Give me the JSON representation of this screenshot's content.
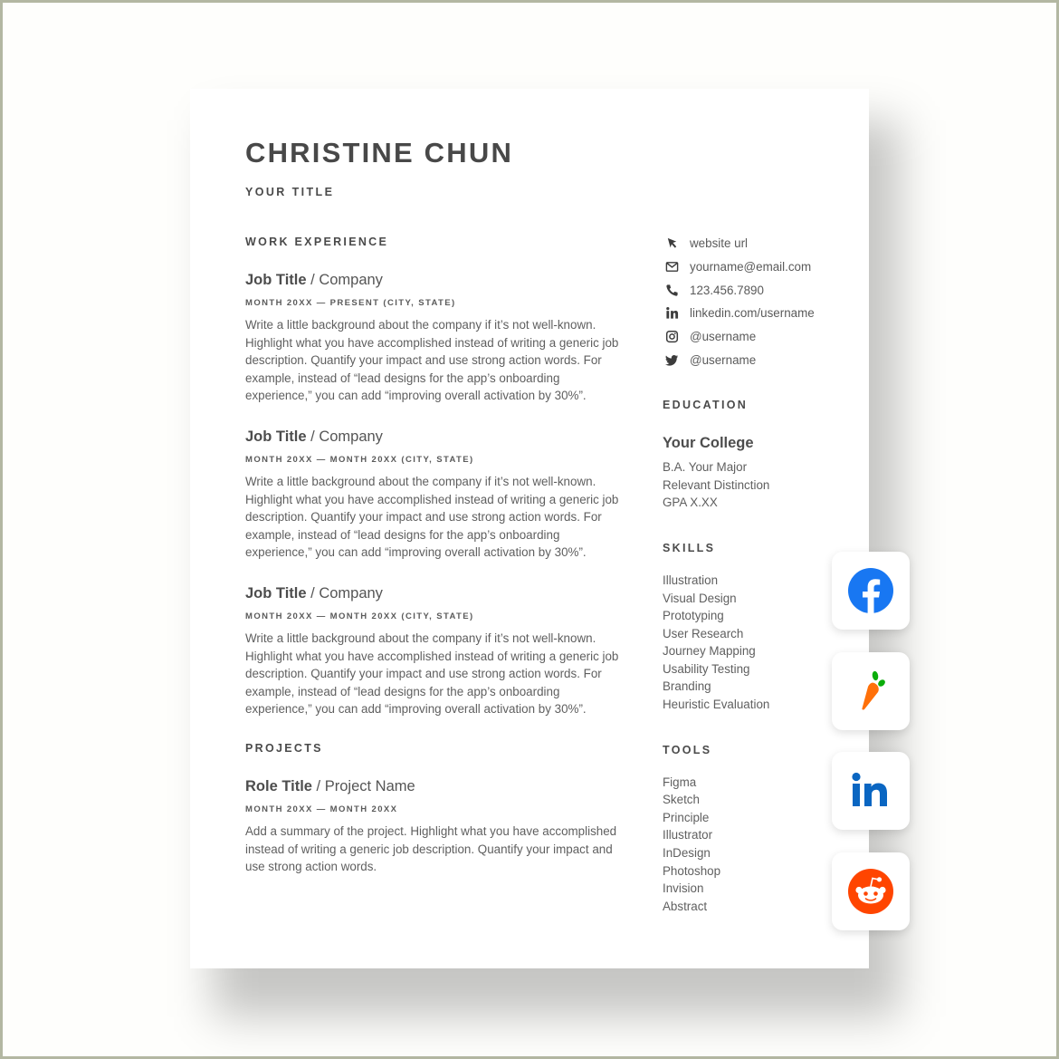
{
  "resume": {
    "name": "CHRISTINE CHUN",
    "title": "YOUR TITLE",
    "work_experience": {
      "heading": "WORK EXPERIENCE",
      "entries": [
        {
          "role": "Job Title",
          "separator": " / ",
          "org": "Company",
          "meta": "MONTH 20XX — PRESENT (CITY, STATE)",
          "description": "Write a little background about the company if it’s not well-known. Highlight what you have accomplished instead of writing a generic job description. Quantify your impact and use strong action words. For example, instead of “lead designs for the app’s onboarding experience,” you can add “improving overall activation by 30%”."
        },
        {
          "role": "Job Title",
          "separator": " / ",
          "org": "Company",
          "meta": "MONTH 20XX — MONTH 20XX (CITY, STATE)",
          "description": "Write a little background about the company if it’s not well-known. Highlight what you have accomplished instead of writing a generic job description. Quantify your impact and use strong action words. For example, instead of “lead designs for the app’s onboarding experience,” you can add “improving overall activation by 30%”."
        },
        {
          "role": "Job Title",
          "separator": " / ",
          "org": "Company",
          "meta": "MONTH 20XX — MONTH 20XX (CITY, STATE)",
          "description": "Write a little background about the company if it’s not well-known. Highlight what you have accomplished instead of writing a generic job description. Quantify your impact and use strong action words. For example, instead of “lead designs for the app’s onboarding experience,” you can add “improving overall activation by 30%”."
        }
      ]
    },
    "projects": {
      "heading": "PROJECTS",
      "entries": [
        {
          "role": "Role Title",
          "separator": " / ",
          "org": "Project Name",
          "meta": "MONTH 20XX — MONTH 20XX",
          "description": "Add a summary of the project. Highlight what you have accomplished instead of writing a generic job description. Quantify your impact and use strong action words."
        }
      ]
    },
    "contact": [
      {
        "icon": "cursor-icon",
        "text": "website url"
      },
      {
        "icon": "mail-icon",
        "text": "yourname@email.com"
      },
      {
        "icon": "phone-icon",
        "text": "123.456.7890"
      },
      {
        "icon": "linkedin-icon",
        "text": "linkedin.com/username"
      },
      {
        "icon": "instagram-icon",
        "text": "@username"
      },
      {
        "icon": "twitter-icon",
        "text": "@username"
      }
    ],
    "education": {
      "heading": "EDUCATION",
      "school": "Your College",
      "lines": [
        "B.A. Your Major",
        "Relevant Distinction",
        "GPA X.XX"
      ]
    },
    "skills": {
      "heading": "SKILLS",
      "items": [
        "Illustration",
        "Visual Design",
        "Prototyping",
        "User Research",
        "Journey Mapping",
        "Usability Testing",
        "Branding",
        "Heuristic Evaluation"
      ]
    },
    "tools": {
      "heading": "TOOLS",
      "items": [
        "Figma",
        "Sketch",
        "Principle",
        "Illustrator",
        "InDesign",
        "Photoshop",
        "Invision",
        "Abstract"
      ]
    }
  },
  "social_badges": [
    {
      "icon": "facebook-icon",
      "color": "#1877f2"
    },
    {
      "icon": "instacart-carrot-icon",
      "color": "#ff7009",
      "leaf_color": "#0aad0a"
    },
    {
      "icon": "linkedin-logo-icon",
      "color": "#0a66c2"
    },
    {
      "icon": "reddit-icon",
      "color": "#ff4500"
    }
  ],
  "colors": {
    "text_dark": "#484848",
    "text_body": "#5f5f5f",
    "frame_border": "#b3b7a2"
  }
}
